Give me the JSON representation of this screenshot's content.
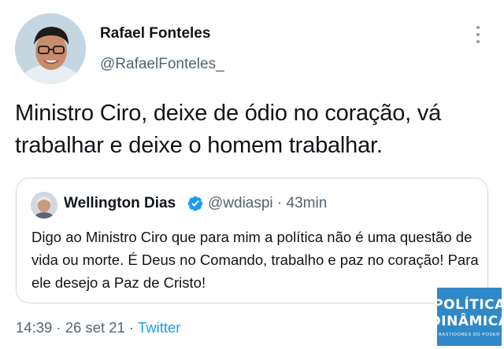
{
  "author": {
    "name": "Rafael Fonteles",
    "handle": "@RafaelFonteles_"
  },
  "tweet": {
    "text": "Ministro Ciro, deixe de ódio no coração, vá trabalhar e deixe o homem trabalhar."
  },
  "quoted_tweet": {
    "name": "Wellington Dias",
    "handle_time": "@wdiaspi · 43min",
    "text": "Digo ao Ministro Ciro que para mim a política não é uma questão de vida ou morte. É Deus no Comando, trabalho e paz no coração! Para ele desejo a Paz de Cristo!",
    "verified": true
  },
  "meta": {
    "timestamp": "14:39 · 26 set 21 · ",
    "source": "Twitter"
  },
  "watermark": {
    "line1": "POLÍTICA",
    "line2": "DINÂMICA",
    "tagline": "BASTIDORES DO PODER"
  },
  "colors": {
    "link": "#1d9bf0",
    "secondary_text": "#536471",
    "border": "#cfd9de",
    "verified_badge": "#1d9bf0",
    "watermark_bg": "#2f88c8"
  },
  "icons": {
    "more": "more-options-icon",
    "verified": "verified-badge-icon"
  }
}
